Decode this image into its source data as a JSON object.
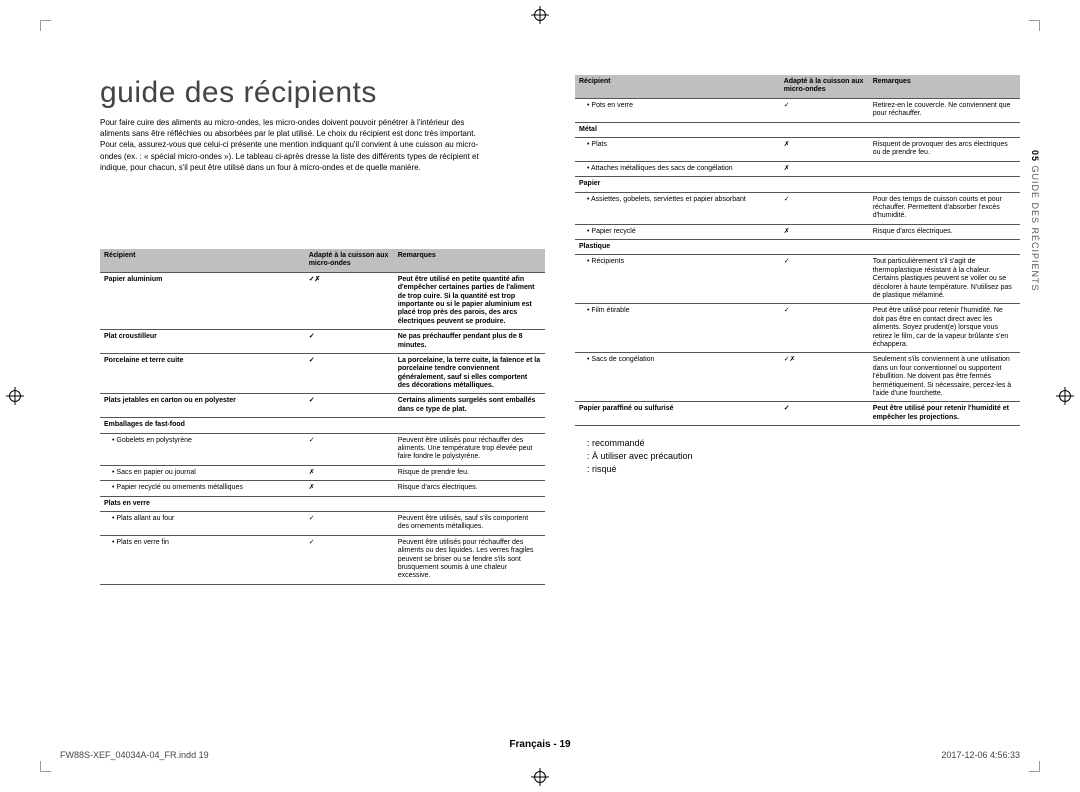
{
  "title": "guide des récipients",
  "intro": "Pour faire cuire des aliments au micro-ondes, les micro-ondes doivent pouvoir pénétrer à l'intérieur des aliments sans être réfléchies ou absorbées par le plat utilisé. Le choix du récipient est donc très important. Pour cela, assurez-vous que celui-ci présente une mention indiquant qu'il convient à une cuisson au micro-ondes (ex. : « spécial micro-ondes »). Le tableau ci-après dresse la liste des différents types de récipient et indique, pour chacun, s'il peut être utilisé dans un four à micro-ondes et de quelle manière.",
  "side": {
    "number": "05",
    "title": "GUIDE DES RÉCIPIENTS"
  },
  "headers": {
    "recipient": "Récipient",
    "suitable": "Adapté à la cuisson aux micro-ondes",
    "remarks": "Remarques"
  },
  "left_rows": [
    {
      "type": "cat",
      "name": "Papier aluminium",
      "mark": "✓✗",
      "note": "Peut être utilisé en petite quantité afin d'empêcher certaines parties de l'aliment de trop cuire. Si la quantité est trop importante ou si le papier aluminium est placé trop près des parois, des arcs électriques peuvent se produire."
    },
    {
      "type": "cat",
      "name": "Plat croustilleur",
      "mark": "✓",
      "note": "Ne pas préchauffer pendant plus de 8 minutes."
    },
    {
      "type": "cat",
      "name": "Porcelaine et terre cuite",
      "mark": "✓",
      "note": "La porcelaine, la terre cuite, la faïence et la porcelaine tendre conviennent généralement, sauf si elles comportent des décorations métalliques."
    },
    {
      "type": "cat",
      "name": "Plats jetables en carton ou en polyester",
      "mark": "✓",
      "note": "Certains aliments surgelés sont emballés dans ce type de plat."
    },
    {
      "type": "cat",
      "name": "Emballages de fast-food",
      "mark": "",
      "note": ""
    },
    {
      "type": "sub",
      "name": "• Gobelets en polystyrène",
      "mark": "✓",
      "note": "Peuvent être utilisés pour réchauffer des aliments. Une température trop élevée peut faire fondre le polystyrène."
    },
    {
      "type": "sub",
      "name": "• Sacs en papier ou journal",
      "mark": "✗",
      "note": "Risque de prendre feu."
    },
    {
      "type": "sub",
      "name": "• Papier recyclé ou ornements métalliques",
      "mark": "✗",
      "note": "Risque d'arcs électriques."
    },
    {
      "type": "cat",
      "name": "Plats en verre",
      "mark": "",
      "note": ""
    },
    {
      "type": "sub",
      "name": "• Plats allant au four",
      "mark": "✓",
      "note": "Peuvent être utilisés, sauf s'ils comportent des ornements métalliques."
    },
    {
      "type": "sub",
      "name": "• Plats en verre fin",
      "mark": "✓",
      "note": "Peuvent être utilisés pour réchauffer des aliments ou des liquides. Les verres fragiles peuvent se briser ou se fendre s'ils sont brusquement soumis à une chaleur excessive."
    }
  ],
  "right_rows": [
    {
      "type": "sub",
      "name": "• Pots en verre",
      "mark": "✓",
      "note": "Retirez-en le couvercle. Ne conviennent que pour réchauffer."
    },
    {
      "type": "cat",
      "name": "Métal",
      "mark": "",
      "note": ""
    },
    {
      "type": "sub",
      "name": "• Plats",
      "mark": "✗",
      "note": "Risquent de provoquer des arcs électriques ou de prendre feu."
    },
    {
      "type": "sub",
      "name": "• Attaches métalliques des sacs de congélation",
      "mark": "✗",
      "note": ""
    },
    {
      "type": "cat",
      "name": "Papier",
      "mark": "",
      "note": ""
    },
    {
      "type": "sub",
      "name": "• Assiettes, gobelets, serviettes et papier absorbant",
      "mark": "✓",
      "note": "Pour des temps de cuisson courts et pour réchauffer. Permettent d'absorber l'excès d'humidité."
    },
    {
      "type": "sub",
      "name": "• Papier recyclé",
      "mark": "✗",
      "note": "Risque d'arcs électriques."
    },
    {
      "type": "cat",
      "name": "Plastique",
      "mark": "",
      "note": ""
    },
    {
      "type": "sub",
      "name": "• Récipients",
      "mark": "✓",
      "note": "Tout particulièrement s'il s'agit de thermoplastique résistant à la chaleur. Certains plastiques peuvent se voiler ou se décolorer à haute température. N'utilisez pas de plastique mélaminé."
    },
    {
      "type": "sub",
      "name": "• Film étirable",
      "mark": "✓",
      "note": "Peut être utilisé pour retenir l'humidité. Ne doit pas être en contact direct avec les aliments. Soyez prudent(e) lorsque vous retirez le film, car de la vapeur brûlante s'en échappera."
    },
    {
      "type": "sub",
      "name": "• Sacs de congélation",
      "mark": "✓✗",
      "note": "Seulement s'ils conviennent à une utilisation dans un four conventionnel ou supportent l'ébullition. Ne doivent pas être fermés hermétiquement. Si nécessaire, percez-les à l'aide d'une fourchette."
    },
    {
      "type": "cat",
      "name": "Papier paraffiné ou sulfurisé",
      "mark": "✓",
      "note": "Peut être utilisé pour retenir l'humidité et empêcher les projections."
    }
  ],
  "legend": {
    "rec": ": recommandé",
    "caution": ": À utiliser avec précaution",
    "risky": ": risqué"
  },
  "footer": {
    "center": "Français - 19",
    "left": "FW88S-XEF_04034A-04_FR.indd   19",
    "right": "2017-12-06   4:56:33"
  }
}
